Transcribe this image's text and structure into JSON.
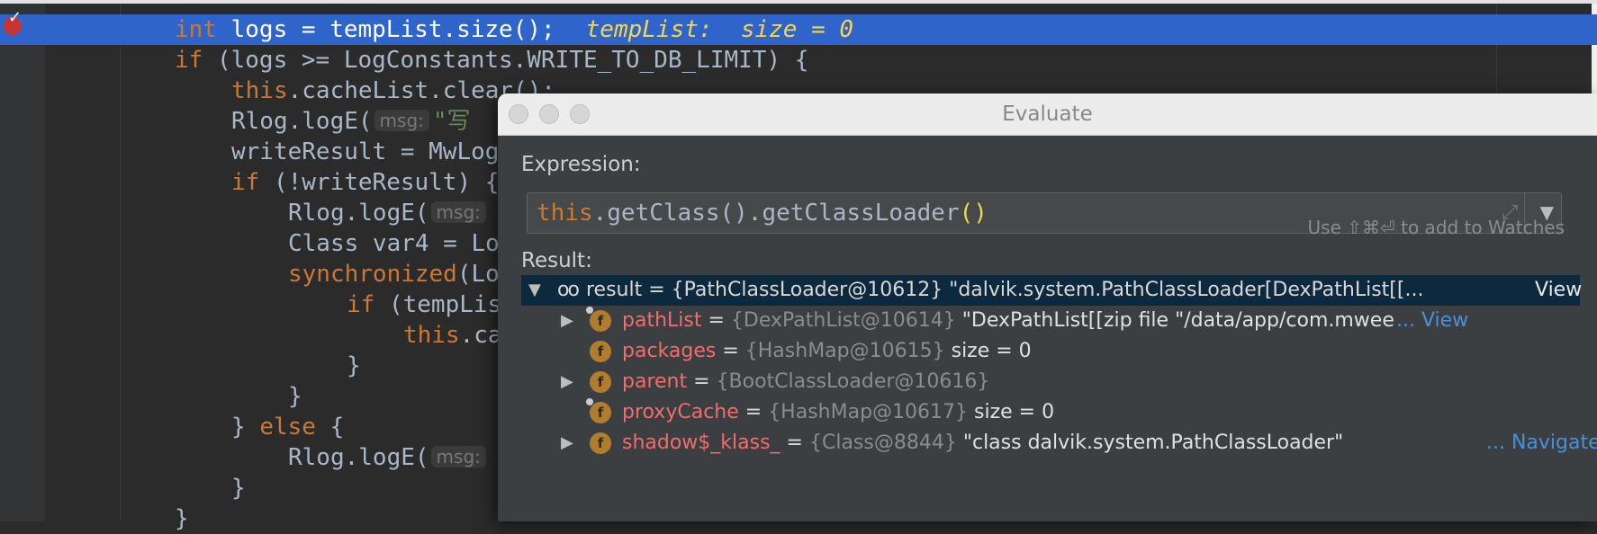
{
  "editor": {
    "lines": [
      {
        "segments": [
          {
            "t": "int",
            "c": "kw"
          },
          {
            "t": " logs = tempList.size();",
            "c": "pl"
          }
        ],
        "inline_value": "tempList:  size = 0"
      },
      {
        "segments": [
          {
            "t": "if",
            "c": "kw"
          },
          {
            "t": " (logs >= LogConstants.WRITE_TO_DB_LIMIT) {",
            "c": "pl"
          }
        ]
      },
      {
        "segments": [
          {
            "t": "this",
            "c": "kw"
          },
          {
            "t": ".cacheList.clear();",
            "c": "pl"
          }
        ]
      },
      {
        "segments": [
          {
            "t": "Rlog.logE(",
            "c": "pl"
          },
          {
            "hint": "msg:"
          },
          {
            "t": "\"写",
            "c": "str"
          }
        ]
      },
      {
        "segments": [
          {
            "t": "writeResult = MwLog",
            "c": "pl"
          }
        ]
      },
      {
        "segments": [
          {
            "t": "if",
            "c": "kw"
          },
          {
            "t": " (!writeResult) {",
            "c": "pl"
          }
        ]
      },
      {
        "segments": [
          {
            "t": "Rlog.logE(",
            "c": "pl"
          },
          {
            "hint": "msg:"
          }
        ]
      },
      {
        "segments": [
          {
            "t": "Class var4 = Lo",
            "c": "pl"
          }
        ]
      },
      {
        "segments": [
          {
            "t": "synchronized",
            "c": "kw"
          },
          {
            "t": "(Lo",
            "c": "pl"
          }
        ]
      },
      {
        "segments": [
          {
            "t": "if",
            "c": "kw"
          },
          {
            "t": " (tempLis",
            "c": "pl"
          }
        ]
      },
      {
        "segments": [
          {
            "t": "this",
            "c": "kw"
          },
          {
            "t": ".ca",
            "c": "pl"
          }
        ]
      },
      {
        "segments": [
          {
            "t": "}",
            "c": "pl"
          }
        ]
      },
      {
        "segments": [
          {
            "t": "}",
            "c": "pl"
          }
        ]
      },
      {
        "segments": [
          {
            "t": "} ",
            "c": "pl"
          },
          {
            "t": "else",
            "c": "kw"
          },
          {
            "t": " {",
            "c": "pl"
          }
        ]
      },
      {
        "segments": [
          {
            "t": "Rlog.logE(",
            "c": "pl"
          },
          {
            "hint": "msg:"
          }
        ]
      },
      {
        "segments": [
          {
            "t": "}",
            "c": "pl"
          }
        ]
      },
      {
        "segments": [
          {
            "t": "}",
            "c": "pl"
          }
        ]
      }
    ]
  },
  "dialog": {
    "title": "Evaluate",
    "expression_label": "Expression:",
    "expression": {
      "keyword": "this",
      "rest": ".getClass().getClassLoader",
      "parens": "()"
    },
    "watch_hint": "Use ⇧⌘⏎ to add to Watches",
    "result_label": "Result:",
    "tree": [
      {
        "expanded": true,
        "icon": "infinity-icon",
        "text": "result = {PathClassLoader@10612} \"dalvik.system.PathClassLoader[DexPathList[[...",
        "link": "View"
      },
      {
        "collapsed": true,
        "icon": "field-icon",
        "locked": true,
        "name": "pathList",
        "type": "{DexPathList@10614}",
        "value": "\"DexPathList[[zip file \"/data/app/com.mwee.ar",
        "link": "... View"
      },
      {
        "icon": "field-icon",
        "name": "packages",
        "type": "{HashMap@10615}",
        "value": "size = 0"
      },
      {
        "collapsed": true,
        "icon": "field-icon",
        "name": "parent",
        "type": "{BootClassLoader@10616}",
        "value": ""
      },
      {
        "icon": "field-icon",
        "locked": true,
        "name": "proxyCache",
        "type": "{HashMap@10617}",
        "value": "size = 0"
      },
      {
        "collapsed": true,
        "icon": "field-icon",
        "name": "shadow$_klass_",
        "type": "{Class@8844}",
        "value": "\"class dalvik.system.PathClassLoader\"",
        "link": "... Navigate"
      }
    ]
  },
  "colors": {
    "editor_bg": "#2b2b2b",
    "current_line": "#2f65ca",
    "keyword": "#cc7832",
    "field_name": "#ef6d6d",
    "field_icon": "#b07d2e",
    "link": "#4a90d9",
    "selected_row": "#0d293e"
  }
}
